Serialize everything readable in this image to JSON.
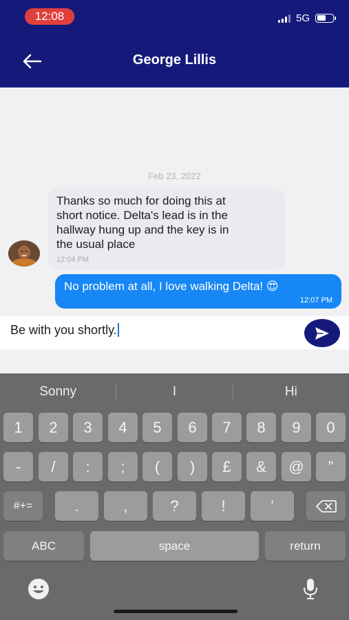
{
  "status_bar": {
    "time": "12:08",
    "network": "5G",
    "battery_level": 0.55
  },
  "header": {
    "title": "George Lillis"
  },
  "chat": {
    "date": "Feb 23, 2022",
    "incoming": {
      "lines": [
        "Thanks so much for doing this at",
        "short notice. Delta's lead is in the",
        "hallway hung up and the key is in",
        "the usual place"
      ],
      "time": "12:04 PM"
    },
    "outgoing": {
      "text": "No problem at all, I love walking Delta! 😍",
      "time": "12:07 PM"
    }
  },
  "composer": {
    "value": "Be with you shortly."
  },
  "keyboard": {
    "predictions": [
      "Sonny",
      "I",
      "Hi"
    ],
    "row1": [
      "1",
      "2",
      "3",
      "4",
      "5",
      "6",
      "7",
      "8",
      "9",
      "0"
    ],
    "row2": [
      "-",
      "/",
      ":",
      ";",
      "(",
      ")",
      "£",
      "&",
      "@",
      "”"
    ],
    "row3": {
      "shift": "#+=",
      "keys": [
        ".",
        ",",
        "?",
        "!",
        "’"
      ]
    },
    "abc": "ABC",
    "space": "space",
    "return": "return"
  },
  "colors": {
    "header": "#151a7a",
    "outgoing_bubble": "#1787f5",
    "time_pill": "#e0403c"
  }
}
